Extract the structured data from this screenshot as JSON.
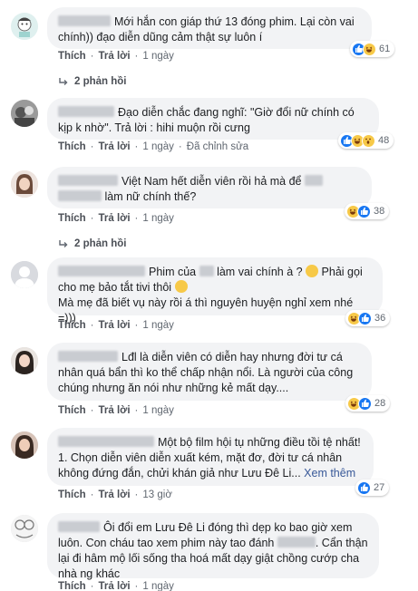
{
  "comments": [
    {
      "text": "Mới hắn con giáp thứ 13 đóng phim. Lại còn vai chính)) đạo diễn dũng cảm thật sự luôn í",
      "reaction_count": "61",
      "actions": {
        "like": "Thích",
        "reply": "Trả lời",
        "time": "1 ngày"
      },
      "replies_label": "2 phản hồi"
    },
    {
      "text": "Đạo diễn chắc đang nghĩ: \"Giờ đổi nữ chính có kịp k nhờ\". Trả lời : hihi muộn rồi cưng",
      "reaction_count": "48",
      "actions": {
        "like": "Thích",
        "reply": "Trả lời",
        "time": "1 ngày",
        "edited": "Đã chỉnh sửa"
      }
    },
    {
      "text_a": "Việt Nam hết diễn viên rồi hả mà để",
      "text_b": "làm nữ chính thế?",
      "reaction_count": "38",
      "actions": {
        "like": "Thích",
        "reply": "Trả lời",
        "time": "1 ngày"
      },
      "replies_label": "2 phản hồi"
    },
    {
      "text_a": "Phim của",
      "text_b": "làm vai chính à ?",
      "text_c": "Phải gọi cho mẹ bảo tắt tivi thôi",
      "text_d": "Mà mẹ đã biết vụ này rồi á thì nguyên huyện nghỉ xem nhé =)))",
      "reaction_count": "36",
      "actions": {
        "like": "Thích",
        "reply": "Trả lời",
        "time": "1 ngày"
      }
    },
    {
      "text": "Lđl là diễn viên có diễn hay nhưng đời tư cá nhân quá bẩn thì ko thể chấp nhận nổi. Là người của công chúng nhưng ăn nói như những kẻ mất dạy....",
      "reaction_count": "28",
      "actions": {
        "like": "Thích",
        "reply": "Trả lời",
        "time": "1 ngày"
      }
    },
    {
      "text_a": "Một bộ film hội tụ những điều tồi tệ nhất!",
      "text_b": "1. Chọn diễn viên diễn xuất kém, mặt đơ, đời tư cá nhân không đứng đắn, chửi khán giả như Lưu Đê Li...",
      "see_more": "Xem thêm",
      "reaction_count": "27",
      "actions": {
        "like": "Thích",
        "reply": "Trả lời",
        "time": "13 giờ"
      }
    },
    {
      "text_a": "Ôi đổi em Lưu Đê Li đóng thì dẹp ko bao giờ xem luôn. Con cháu tao xem phim này tao đánh",
      "text_b": ". Cẩn thận lại đi hâm mộ lối sống tha hoá mất dạy giật chồng cướp cha nhà ng khác",
      "actions": {
        "like": "Thích",
        "reply": "Trả lời",
        "time": "1 ngày"
      }
    }
  ],
  "colors": {
    "bubble": "#f2f3f5",
    "like": "#1877f2",
    "haha": "#f7c948",
    "meta": "#606770"
  }
}
